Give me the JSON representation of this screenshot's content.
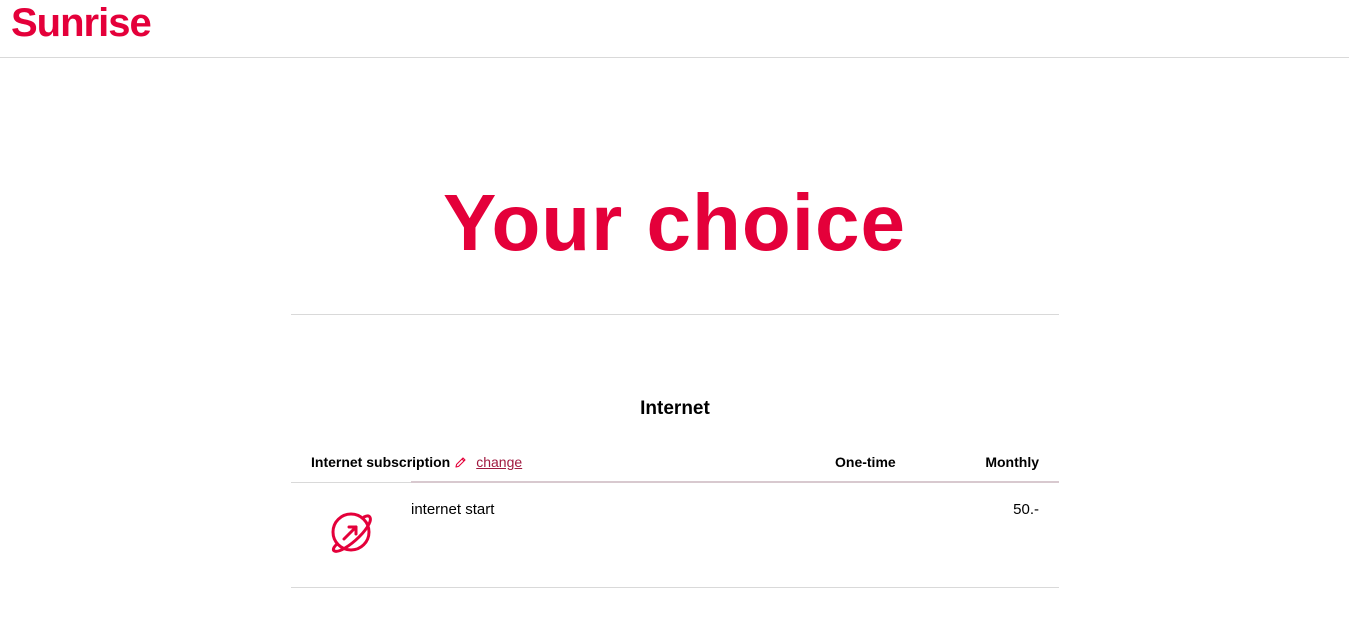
{
  "header": {
    "logo_text": "Sunrise"
  },
  "main": {
    "title": "Your choice",
    "section": {
      "title": "Internet",
      "table": {
        "subscription_header": "Internet subscription",
        "change_label": "change",
        "onetime_header": "One-time",
        "monthly_header": "Monthly",
        "rows": [
          {
            "icon": "internet-globe-icon",
            "name": "internet start",
            "onetime": "",
            "monthly": "50.-"
          }
        ]
      }
    }
  },
  "colors": {
    "brand": "#e4003a",
    "link": "#a0193f",
    "divider": "#d9d9d9"
  }
}
